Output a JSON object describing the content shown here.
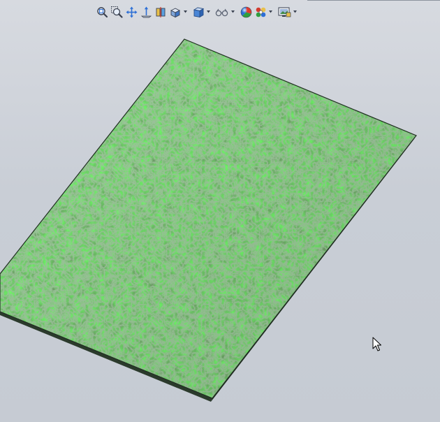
{
  "toolbar": {
    "tools": [
      {
        "icon": "zoom-to-fit-icon",
        "tooltip": ""
      },
      {
        "icon": "zoom-to-area-icon",
        "tooltip": ""
      },
      {
        "icon": "pan-icon",
        "tooltip": ""
      },
      {
        "icon": "normal-to-icon",
        "tooltip": ""
      },
      {
        "icon": "section-view-icon",
        "tooltip": ""
      },
      {
        "icon": "view-orientation-icon",
        "tooltip": ""
      },
      {
        "icon": "display-style-icon",
        "tooltip": ""
      },
      {
        "icon": "hide-show-items-icon",
        "tooltip": ""
      },
      {
        "icon": "edit-appearance-icon",
        "tooltip": ""
      },
      {
        "icon": "apply-scene-icon",
        "tooltip": ""
      },
      {
        "icon": "view-settings-icon",
        "tooltip": ""
      }
    ]
  },
  "model": {
    "part": "textured-plate",
    "appearance": "foliage-texture",
    "colors": {
      "texture_base": "#3b6b3c",
      "texture_dark": "#1d3a20",
      "texture_light": "#5f9a5c",
      "edge": "#2b3a2c"
    }
  },
  "colors": {
    "background_top": "#d7dae0",
    "background_bottom": "#c6cbd3",
    "icon_blue": "#2d6fd6",
    "icon_dark": "#3a4150"
  }
}
